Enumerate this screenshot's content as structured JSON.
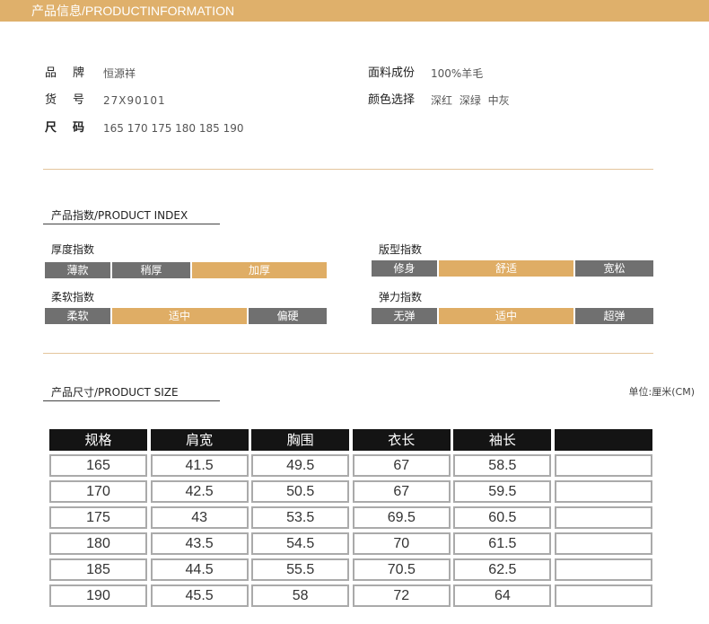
{
  "colors": {
    "accent": "#dfb06b",
    "selected": "#dfad65",
    "unselected": "#707070",
    "divider": "#e4c59c"
  },
  "header": {
    "title": "产品信息/PRODUCTINFORMATION"
  },
  "info": {
    "brand": {
      "label": "品 牌",
      "value": "恒源祥"
    },
    "item_number": {
      "label": "货 号",
      "value": "27X90101"
    },
    "size": {
      "label": "尺 码",
      "value": "165 170 175 180 185 190"
    },
    "material": {
      "label": "面料成份",
      "value": "100%羊毛"
    },
    "color": {
      "label": "颜色选择",
      "value": "深红 深绿 中灰"
    }
  },
  "index": {
    "title": "产品指数/PRODUCT INDEX",
    "thickness": {
      "name": "厚度指数",
      "options": [
        "薄款",
        "稍厚",
        "加厚"
      ],
      "selected": 2
    },
    "softness": {
      "name": "柔软指数",
      "options": [
        "柔软",
        "适中",
        "偏硬"
      ],
      "selected": 1
    },
    "fit": {
      "name": "版型指数",
      "options": [
        "修身",
        "舒适",
        "宽松"
      ],
      "selected": 1
    },
    "elasticity": {
      "name": "弹力指数",
      "options": [
        "无弹",
        "适中",
        "超弹"
      ],
      "selected": 1
    }
  },
  "size_table": {
    "title": "产品尺寸/PRODUCT SIZE",
    "unit": "单位:厘米(CM)",
    "headers": [
      "规格",
      "肩宽",
      "胸围",
      "衣长",
      "袖长",
      ""
    ],
    "rows": [
      [
        "165",
        "41.5",
        "49.5",
        "67",
        "58.5",
        ""
      ],
      [
        "170",
        "42.5",
        "50.5",
        "67",
        "59.5",
        ""
      ],
      [
        "175",
        "43",
        "53.5",
        "69.5",
        "60.5",
        ""
      ],
      [
        "180",
        "43.5",
        "54.5",
        "70",
        "61.5",
        ""
      ],
      [
        "185",
        "44.5",
        "55.5",
        "70.5",
        "62.5",
        ""
      ],
      [
        "190",
        "45.5",
        "58",
        "72",
        "64",
        ""
      ]
    ]
  }
}
